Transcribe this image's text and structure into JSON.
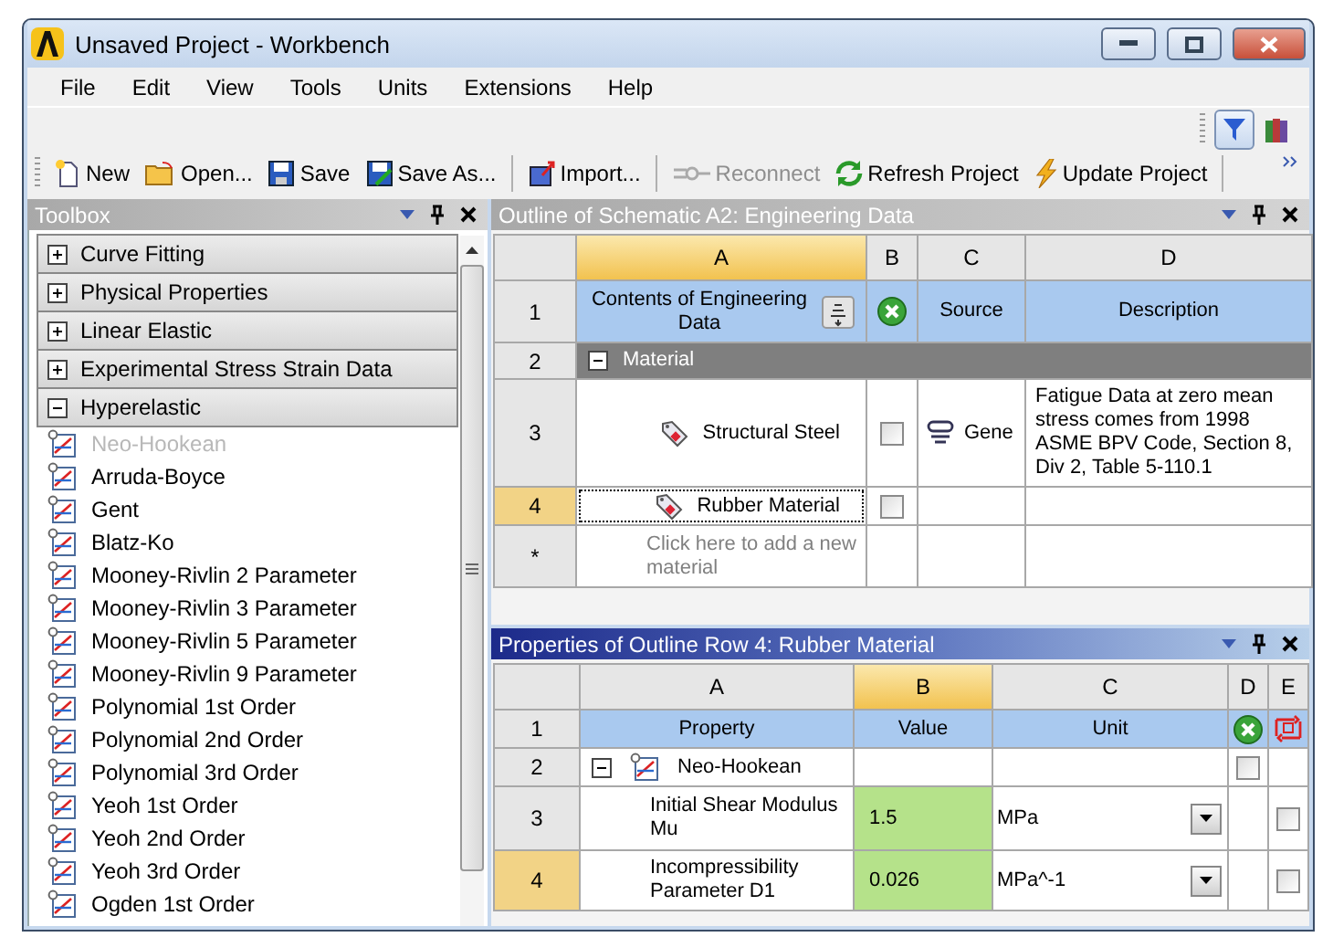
{
  "window": {
    "title": "Unsaved Project - Workbench"
  },
  "menu": [
    "File",
    "Edit",
    "View",
    "Tools",
    "Units",
    "Extensions",
    "Help"
  ],
  "toolbar": {
    "groups": [
      {
        "buttons": [
          {
            "label": "New",
            "disabled": false
          },
          {
            "label": "Open...",
            "disabled": false
          },
          {
            "label": "Save",
            "disabled": false
          },
          {
            "label": "Save As...",
            "disabled": false
          }
        ]
      },
      {
        "buttons": [
          {
            "label": "Import...",
            "disabled": false
          }
        ]
      },
      {
        "buttons": [
          {
            "label": "Reconnect",
            "disabled": true
          },
          {
            "label": "Refresh Project",
            "disabled": false
          },
          {
            "label": "Update Project",
            "disabled": false
          }
        ]
      }
    ],
    "filter_on": true
  },
  "toolbox": {
    "title": "Toolbox",
    "categories": [
      {
        "label": "Curve Fitting",
        "expanded": false
      },
      {
        "label": "Physical Properties",
        "expanded": false
      },
      {
        "label": "Linear Elastic",
        "expanded": false
      },
      {
        "label": "Experimental Stress Strain Data",
        "expanded": false
      },
      {
        "label": "Hyperelastic",
        "expanded": true,
        "items": [
          {
            "label": "Neo-Hookean",
            "disabled": true
          },
          {
            "label": "Arruda-Boyce",
            "disabled": false
          },
          {
            "label": "Gent",
            "disabled": false
          },
          {
            "label": "Blatz-Ko",
            "disabled": false
          },
          {
            "label": "Mooney-Rivlin 2 Parameter",
            "disabled": false
          },
          {
            "label": "Mooney-Rivlin 3 Parameter",
            "disabled": false
          },
          {
            "label": "Mooney-Rivlin 5 Parameter",
            "disabled": false
          },
          {
            "label": "Mooney-Rivlin 9 Parameter",
            "disabled": false
          },
          {
            "label": "Polynomial 1st Order",
            "disabled": false
          },
          {
            "label": "Polynomial 2nd Order",
            "disabled": false
          },
          {
            "label": "Polynomial 3rd Order",
            "disabled": false
          },
          {
            "label": "Yeoh 1st Order",
            "disabled": false
          },
          {
            "label": "Yeoh 2nd Order",
            "disabled": false
          },
          {
            "label": "Yeoh 3rd Order",
            "disabled": false
          },
          {
            "label": "Ogden 1st Order",
            "disabled": false
          }
        ]
      }
    ]
  },
  "outline": {
    "title": "Outline of Schematic A2: Engineering Data",
    "active": false,
    "columns": [
      {
        "label": "A",
        "selected": true
      },
      {
        "label": "B",
        "selected": false
      },
      {
        "label": "C",
        "selected": false
      },
      {
        "label": "D",
        "selected": false
      }
    ],
    "rows": [
      {
        "number": "1",
        "kind": "header",
        "selected": false,
        "cells": [
          {
            "kind": "sort",
            "text": "Contents of Engineering Data"
          },
          {
            "kind": "clear"
          },
          {
            "kind": "center",
            "text": "Source"
          },
          {
            "kind": "center",
            "text": "Description"
          }
        ]
      },
      {
        "number": "2",
        "kind": "group",
        "selected": false,
        "cells": [
          {
            "kind": "group",
            "text": "Material",
            "expanded": true
          }
        ]
      },
      {
        "number": "3",
        "kind": "item",
        "selected": false,
        "cells": [
          {
            "kind": "material",
            "text": "Structural Steel",
            "focused": false
          },
          {
            "kind": "checkbox",
            "checked": false
          },
          {
            "kind": "link",
            "text": "Gene"
          },
          {
            "kind": "note",
            "text": "Fatigue Data at zero mean stress comes from 1998 ASME BPV Code, Section 8, Div 2, Table 5-110.1"
          }
        ]
      },
      {
        "number": "4",
        "kind": "item",
        "selected": true,
        "cells": [
          {
            "kind": "material",
            "text": "Rubber Material",
            "focused": true
          },
          {
            "kind": "checkbox",
            "checked": false
          },
          {
            "kind": "blank"
          },
          {
            "kind": "blank"
          }
        ]
      },
      {
        "number": "*",
        "kind": "item",
        "selected": false,
        "cells": [
          {
            "kind": "placeholder",
            "text": "Click here to add a new material"
          },
          {
            "kind": "blank"
          },
          {
            "kind": "blank"
          },
          {
            "kind": "blank"
          }
        ]
      }
    ]
  },
  "properties": {
    "title": "Properties of Outline Row 4: Rubber Material",
    "active": true,
    "columns": [
      {
        "label": "A",
        "selected": false
      },
      {
        "label": "B",
        "selected": true
      },
      {
        "label": "C",
        "selected": false
      },
      {
        "label": "D",
        "selected": false
      },
      {
        "label": "E",
        "selected": false
      }
    ],
    "rows": [
      {
        "number": "1",
        "kind": "header",
        "selected": false,
        "cells": [
          {
            "kind": "center",
            "text": "Property"
          },
          {
            "kind": "center",
            "text": "Value"
          },
          {
            "kind": "center",
            "text": "Unit"
          },
          {
            "kind": "clear"
          },
          {
            "kind": "parameter"
          }
        ]
      },
      {
        "number": "2",
        "kind": "item",
        "selected": false,
        "cells": [
          {
            "kind": "model",
            "text": "Neo-Hookean",
            "expanded": true
          },
          {
            "kind": "blank"
          },
          {
            "kind": "blank"
          },
          {
            "kind": "checkbox",
            "checked": false
          },
          {
            "kind": "blank"
          }
        ]
      },
      {
        "number": "3",
        "kind": "item",
        "selected": false,
        "cells": [
          {
            "kind": "indented",
            "text": "Initial Shear Modulus Mu"
          },
          {
            "kind": "value",
            "text": "1.5"
          },
          {
            "kind": "unit",
            "text": "MPa"
          },
          {
            "kind": "blank"
          },
          {
            "kind": "checkbox",
            "checked": false
          }
        ]
      },
      {
        "number": "4",
        "kind": "item",
        "selected": true,
        "cells": [
          {
            "kind": "indented",
            "text": "Incompressibility Parameter D1"
          },
          {
            "kind": "value",
            "text": "0.026"
          },
          {
            "kind": "unit",
            "text": "MPa^-1"
          },
          {
            "kind": "blank"
          },
          {
            "kind": "checkbox",
            "checked": false
          }
        ]
      }
    ]
  }
}
